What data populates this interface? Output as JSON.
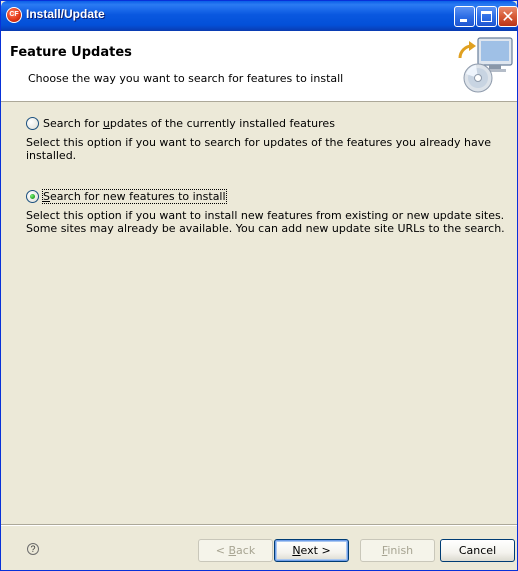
{
  "window": {
    "title": "Install/Update",
    "app_icon_text": "CF",
    "close_glyph": "✕"
  },
  "banner": {
    "title": "Feature Updates",
    "description": "Choose the way you want to search for features to install"
  },
  "options": [
    {
      "label_before": "Search for ",
      "label_mnemonic": "u",
      "label_after": "pdates of the currently installed features",
      "selected": false,
      "help": "Select this option if you want to search for updates of the features you already have installed."
    },
    {
      "label_before": "",
      "label_mnemonic": "S",
      "label_after": "earch for new features to install",
      "selected": true,
      "help": "Select this option if you want to install new features from existing or new update sites. Some sites may already be available. You can add new update site URLs to the search."
    }
  ],
  "footer": {
    "help_glyph": "?",
    "back": {
      "prefix": "< ",
      "mnemonic": "B",
      "rest": "ack",
      "enabled": false
    },
    "next": {
      "mnemonic": "N",
      "rest": "ext >",
      "enabled": true
    },
    "finish": {
      "mnemonic": "F",
      "rest": "inish",
      "enabled": false
    },
    "cancel": {
      "label": "Cancel",
      "enabled": true
    }
  },
  "colors": {
    "titlebar": "#0a58e0",
    "dialog_bg": "#ece9d8",
    "radio_checked": "#21a121"
  },
  "icons": [
    "app-icon",
    "minimize-icon",
    "maximize-icon",
    "close-icon",
    "update-cd-monitor-icon",
    "help-icon"
  ]
}
